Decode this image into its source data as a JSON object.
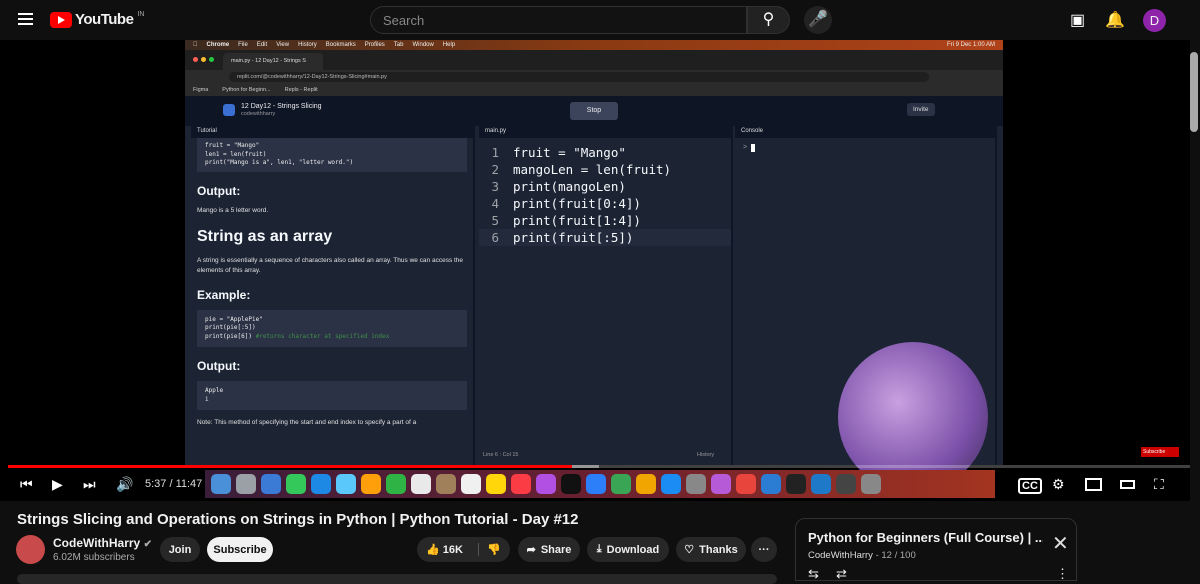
{
  "header": {
    "logo": "YouTube",
    "region": "IN",
    "search_placeholder": "Search",
    "avatar_letter": "D"
  },
  "video": {
    "mac_menu": [
      "Chrome",
      "File",
      "Edit",
      "View",
      "History",
      "Bookmarks",
      "Profiles",
      "Tab",
      "Window",
      "Help"
    ],
    "mac_clock": "Fri 9 Dec 1:00 AM",
    "browser_tab": "main.py - 12 Day12 - Strings S",
    "url": "replit.com/@codewithharry/12-Day12-Strings-Slicing#main.py",
    "bookmarks": [
      "Figma",
      "Python for Beginn...",
      "Repls - Replit"
    ],
    "repl_name": "12 Day12 - Strings Slicing",
    "repl_owner": "codewithharry",
    "stop_label": "Stop",
    "invite_label": "Invite",
    "tutorial": {
      "tab": "Tutorial",
      "code1": [
        "fruit = \"Mango\"",
        "len1 = len(fruit)",
        "print(\"Mango is a\", len1, \"letter word.\")"
      ],
      "output_heading": "Output:",
      "output1": "Mango is a 5 letter word.",
      "section_heading": "String as an array",
      "section_text": "A string is essentially a sequence of characters also called an array. Thus we can access the elements of this array.",
      "example_heading": "Example:",
      "code2": [
        "pie = \"ApplePie\"",
        "print(pie[:5])",
        "print(pie[6])"
      ],
      "code2_comment": "#returns character at specified index",
      "output2_heading": "Output:",
      "output2": [
        "Apple",
        "i"
      ],
      "note": "Note: This method of specifying the start and end index to specify a part of a"
    },
    "editor": {
      "tab": "main.py",
      "lines": [
        {
          "n": "1",
          "code": "fruit = \"Mango\""
        },
        {
          "n": "2",
          "code": "mangoLen = len(fruit)"
        },
        {
          "n": "3",
          "code": "print(mangoLen)"
        },
        {
          "n": "4",
          "code": "print(fruit[0:4])"
        },
        {
          "n": "5",
          "code": "print(fruit[1:4])"
        },
        {
          "n": "6",
          "code": "print(fruit[:5])"
        }
      ],
      "status": "Line 6 : Col 15",
      "history": "History"
    },
    "console": {
      "tab": "Console",
      "prompt": ">"
    },
    "subscribe_watermark": "Subscribe",
    "dock_colors": [
      "#4a90d9",
      "#9aa0a6",
      "#3b7bd6",
      "#34c759",
      "#1e88e5",
      "#5ac8fa",
      "#ff9f0a",
      "#2fb344",
      "#e9e9e9",
      "#a0805a",
      "#f0f0f0",
      "#ffd60a",
      "#fc3c44",
      "#b150e2",
      "#111111",
      "#2d7ff9",
      "#3aa655",
      "#f0a500",
      "#1c8cf5",
      "#888888",
      "#b75ad8",
      "#e8453c",
      "#2b7cd3",
      "#222222",
      "#1e7ac9",
      "#444444",
      "#888888"
    ]
  },
  "player": {
    "time": "5:37 / 11:47",
    "progress": 0.477,
    "buffered": 0.5
  },
  "meta": {
    "title": "Strings Slicing and Operations on Strings in Python | Python Tutorial - Day #12",
    "channel": "CodeWithHarry",
    "subscribers": "6.02M subscribers",
    "join": "Join",
    "subscribe": "Subscribe",
    "likes": "16K",
    "share": "Share",
    "download": "Download",
    "thanks": "Thanks",
    "more": "···"
  },
  "playlist": {
    "title": "Python for Beginners (Full Course) | ...",
    "channel": "CodeWithHarry",
    "position": "12 / 100"
  }
}
